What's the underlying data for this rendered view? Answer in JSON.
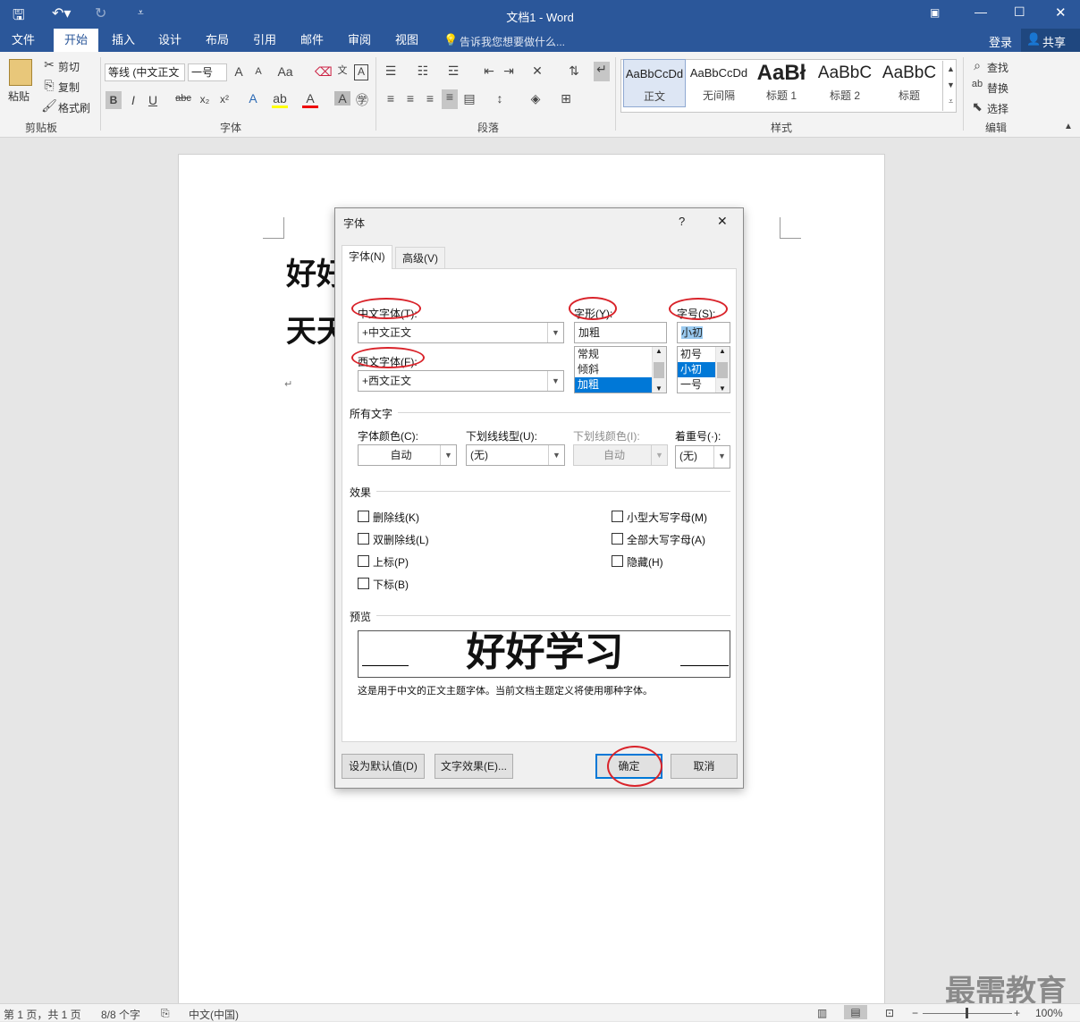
{
  "app": {
    "title": "文档1 - Word",
    "qat_more": "⩡"
  },
  "tabs": [
    "文件",
    "开始",
    "插入",
    "设计",
    "布局",
    "引用",
    "邮件",
    "审阅",
    "视图"
  ],
  "tell_me": "告诉我您想要做什么...",
  "account": {
    "signin": "登录",
    "share": "共享"
  },
  "ribbon": {
    "clipboard": {
      "paste": "粘贴",
      "cut": "剪切",
      "copy": "复制",
      "format_painter": "格式刷",
      "group": "剪贴板"
    },
    "font": {
      "name": "等线 (中文正文",
      "size": "一号",
      "group": "字体"
    },
    "paragraph": {
      "group": "段落"
    },
    "styles": {
      "group": "样式",
      "items": [
        {
          "preview": "AaBbCcDd",
          "name": "正文"
        },
        {
          "preview": "AaBbCcDd",
          "name": "无间隔"
        },
        {
          "preview": "AaBł",
          "name": "标题 1"
        },
        {
          "preview": "AaBbC",
          "name": "标题 2"
        },
        {
          "preview": "AaBbC",
          "name": "标题"
        }
      ]
    },
    "editing": {
      "find": "查找",
      "replace": "替换",
      "select": "选择",
      "group": "编辑"
    }
  },
  "document": {
    "line1": "好好",
    "line2": "天天"
  },
  "dialog": {
    "title": "字体",
    "help": "?",
    "close": "✕",
    "tabs": [
      "字体(N)",
      "高级(V)"
    ],
    "cn_font_label": "中文字体(T):",
    "cn_font_value": "+中文正文",
    "west_font_label": "西文字体(F):",
    "west_font_value": "+西文正文",
    "style_label": "字形(Y):",
    "style_value": "加粗",
    "style_options": [
      "常规",
      "倾斜",
      "加粗"
    ],
    "size_label": "字号(S):",
    "size_value": "小初",
    "size_options": [
      "初号",
      "小初",
      "一号"
    ],
    "all_text_section": "所有文字",
    "font_color_label": "字体颜色(C):",
    "font_color_value": "自动",
    "underline_label": "下划线线型(U):",
    "underline_value": "(无)",
    "underline_color_label": "下划线颜色(I):",
    "underline_color_value": "自动",
    "emphasis_label": "着重号(·):",
    "emphasis_value": "(无)",
    "effects_section": "效果",
    "effects_left": [
      "删除线(K)",
      "双删除线(L)",
      "上标(P)",
      "下标(B)"
    ],
    "effects_right": [
      "小型大写字母(M)",
      "全部大写字母(A)",
      "隐藏(H)"
    ],
    "preview_section": "预览",
    "preview_text": "好好学习",
    "preview_note": "这是用于中文的正文主题字体。当前文档主题定义将使用哪种字体。",
    "set_default": "设为默认值(D)",
    "text_effects": "文字效果(E)...",
    "ok": "确定",
    "cancel": "取消"
  },
  "status": {
    "page": "第 1 页，共 1 页",
    "words": "8/8 个字",
    "lang": "中文(中国)",
    "zoom": "100%"
  },
  "watermark": "最需教育",
  "colors": {
    "accent": "#2b579a",
    "highlight": "#d9232a",
    "selection": "#0078d7"
  }
}
